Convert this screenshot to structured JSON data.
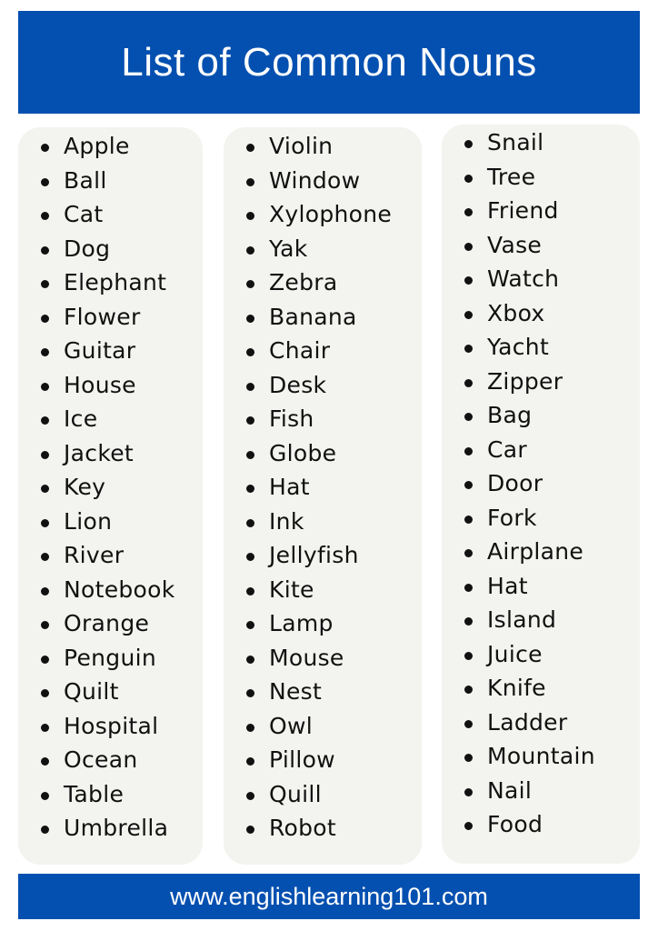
{
  "title": "List of Common Nouns",
  "columns": [
    {
      "items": [
        "Apple",
        "Ball",
        "Cat",
        "Dog",
        "Elephant",
        "Flower",
        "Guitar",
        "House",
        "Ice",
        "Jacket",
        "Key",
        "Lion",
        "River",
        "Notebook",
        "Orange",
        "Penguin",
        "Quilt",
        "Hospital",
        "Ocean",
        "Table",
        "Umbrella"
      ]
    },
    {
      "items": [
        "Violin",
        "Window",
        "Xylophone",
        "Yak",
        "Zebra",
        "Banana",
        "Chair",
        "Desk",
        "Fish",
        "Globe",
        "Hat",
        "Ink",
        "Jellyfish",
        "Kite",
        "Lamp",
        "Mouse",
        "Nest",
        "Owl",
        "Pillow",
        "Quill",
        "Robot"
      ]
    },
    {
      "items": [
        "Snail",
        "Tree",
        "Friend",
        "Vase",
        "Watch",
        "Xbox",
        "Yacht",
        "Zipper",
        "Bag",
        "Car",
        "Door",
        "Fork",
        "Airplane",
        "Hat",
        "Island",
        "Juice",
        "Knife",
        "Ladder",
        "Mountain",
        "Nail",
        "Food"
      ]
    }
  ],
  "footer": "www.englishlearning101.com",
  "colors": {
    "brand_blue": "#0450b0",
    "card_bg": "#f3f3ef",
    "text": "#111111"
  }
}
